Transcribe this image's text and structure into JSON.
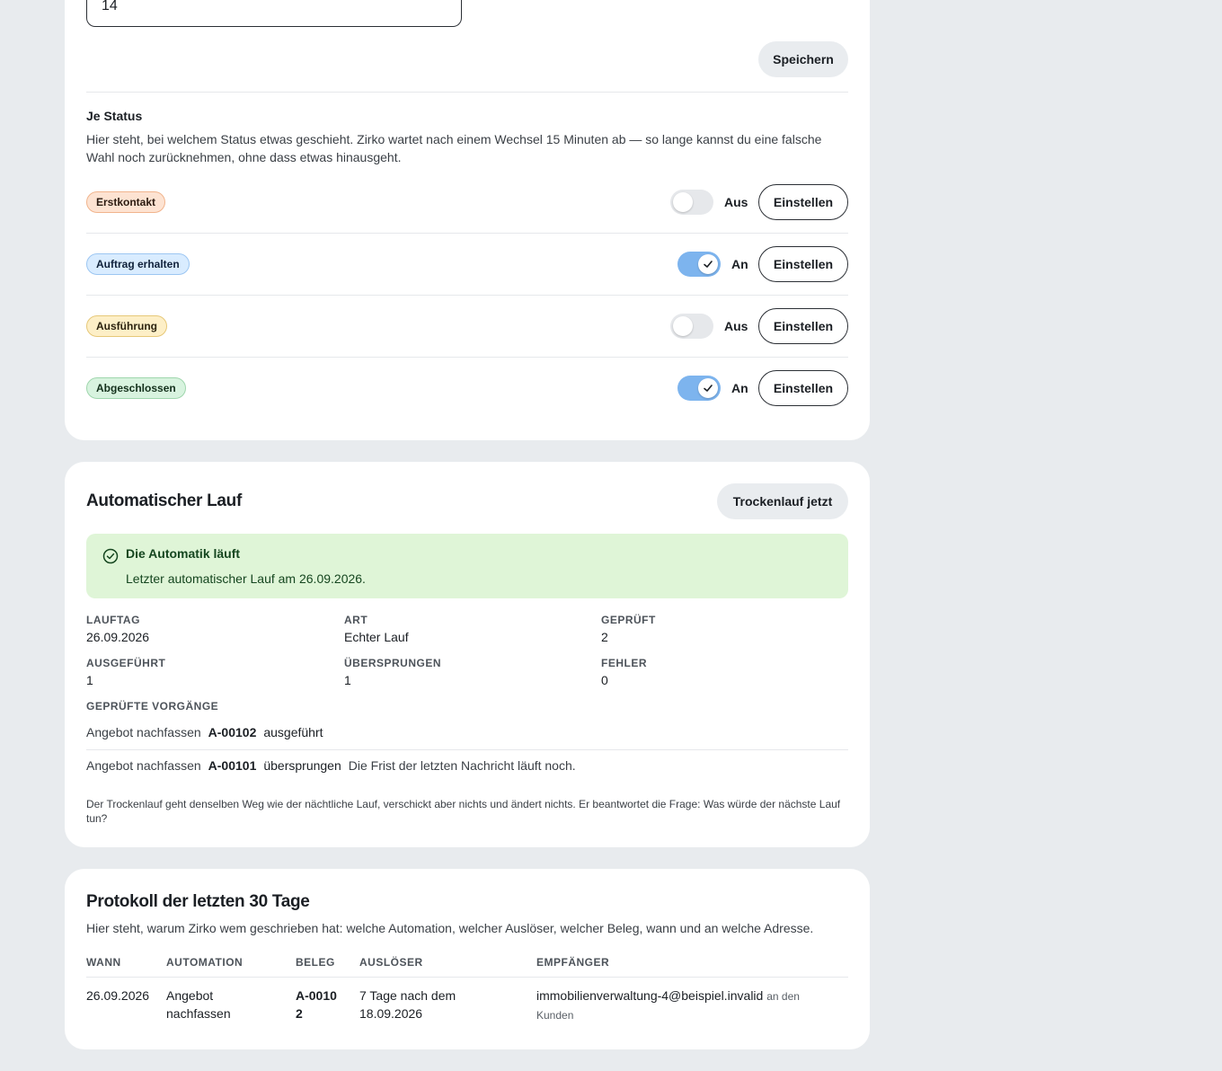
{
  "settings": {
    "days_value": "14",
    "save_label": "Speichern",
    "section_title": "Je Status",
    "section_description": "Hier steht, bei welchem Status etwas geschieht. Zirko wartet nach einem Wechsel 15 Minuten ab — so lange kannst du eine falsche Wahl noch zurücknehmen, ohne dass etwas hinausgeht.",
    "statuses": [
      {
        "label": "Erstkontakt",
        "state": "Aus",
        "button": "Einstellen"
      },
      {
        "label": "Auftrag erhalten",
        "state": "An",
        "button": "Einstellen"
      },
      {
        "label": "Ausführung",
        "state": "Aus",
        "button": "Einstellen"
      },
      {
        "label": "Abgeschlossen",
        "state": "An",
        "button": "Einstellen"
      }
    ]
  },
  "run": {
    "title": "Automatischer Lauf",
    "dry_run_label": "Trockenlauf jetzt",
    "alert_title": "Die Automatik läuft",
    "alert_text": "Letzter automatischer Lauf am 26.09.2026.",
    "stats": [
      {
        "label": "LAUFTAG",
        "value": "26.09.2026"
      },
      {
        "label": "ART",
        "value": "Echter Lauf"
      },
      {
        "label": "GEPRÜFT",
        "value": "2"
      },
      {
        "label": "AUSGEFÜHRT",
        "value": "1"
      },
      {
        "label": "ÜBERSPRUNGEN",
        "value": "1"
      },
      {
        "label": "FEHLER",
        "value": "0"
      }
    ],
    "checked_label": "GEPRÜFTE VORGÄNGE",
    "checked": [
      {
        "type": "Angebot nachfassen",
        "id": "A-00102",
        "result": "ausgeführt",
        "note": ""
      },
      {
        "type": "Angebot nachfassen",
        "id": "A-00101",
        "result": "übersprungen",
        "note": "Die Frist der letzten Nachricht läuft noch."
      }
    ],
    "footnote": "Der Trockenlauf geht denselben Weg wie der nächtliche Lauf, verschickt aber nichts und ändert nichts. Er beantwortet die Frage: Was würde der nächste Lauf tun?"
  },
  "protocol": {
    "title": "Protokoll der letzten 30 Tage",
    "description": "Hier steht, warum Zirko wem geschrieben hat: welche Automation, welcher Auslöser, welcher Beleg, wann und an welche Adresse.",
    "columns": [
      "WANN",
      "AUTOMATION",
      "BELEG",
      "AUSLÖSER",
      "EMPFÄNGER"
    ],
    "rows": [
      {
        "when": "26.09.2026",
        "automation": "Angebot nachfassen",
        "doc": "A-00102",
        "trigger": "7 Tage nach dem 18.09.2026",
        "recipient": "immobilienverwaltung-4@beispiel.invalid",
        "recipient_note": "an den Kunden"
      }
    ]
  }
}
